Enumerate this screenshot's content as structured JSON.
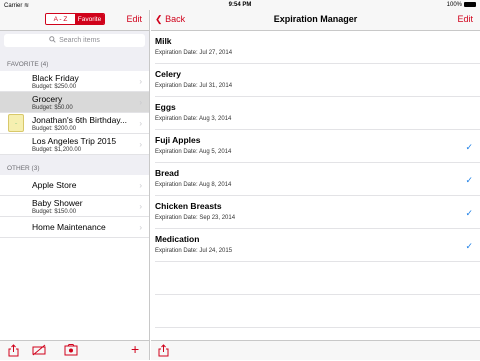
{
  "status_bar": {
    "carrier": "Carrier",
    "wifi_icon": "wifi-icon",
    "time": "9:54 PM",
    "battery": "100%"
  },
  "left": {
    "segment": {
      "az": "A - Z",
      "favorite": "Favorite"
    },
    "edit": "Edit",
    "search_placeholder": "Search items",
    "favorite_header": "FAVORITE (4)",
    "favorites": [
      {
        "name": "Black Friday",
        "budget": "Budget: $250.00"
      },
      {
        "name": "Grocery",
        "budget": "Budget: $50.00"
      },
      {
        "name": "Jonathan's 6th Birthday...",
        "budget": "Budget: $200.00"
      },
      {
        "name": "Los Angeles Trip 2015",
        "budget": "Budget: $1,200.00"
      }
    ],
    "other_header": "OTHER (3)",
    "others": [
      {
        "name": "Apple Store",
        "budget": ""
      },
      {
        "name": "Baby Shower",
        "budget": "Budget: $150.00"
      },
      {
        "name": "Home Maintenance",
        "budget": ""
      }
    ],
    "toolbar": {
      "share": "share-icon",
      "no_image": "no-image-icon",
      "photo": "photo-icon",
      "add": "+"
    }
  },
  "right": {
    "back": "Back",
    "title": "Expiration Manager",
    "edit": "Edit",
    "items": [
      {
        "name": "Milk",
        "date": "Expiration Date: Jul 27, 2014",
        "checked": false
      },
      {
        "name": "Celery",
        "date": "Expiration Date: Jul 31, 2014",
        "checked": false
      },
      {
        "name": "Eggs",
        "date": "Expiration Date: Aug 3, 2014",
        "checked": false
      },
      {
        "name": "Fuji Apples",
        "date": "Expiration Date: Aug 5, 2014",
        "checked": true
      },
      {
        "name": "Bread",
        "date": "Expiration Date: Aug 8, 2014",
        "checked": true
      },
      {
        "name": "Chicken Breasts",
        "date": "Expiration Date: Sep 23, 2014",
        "checked": true
      },
      {
        "name": "Medication",
        "date": "Expiration Date: Jul 24, 2015",
        "checked": true
      }
    ],
    "toolbar": {
      "share": "share-icon"
    }
  },
  "colors": {
    "accent": "#d0021b",
    "check": "#1a7ee6"
  }
}
